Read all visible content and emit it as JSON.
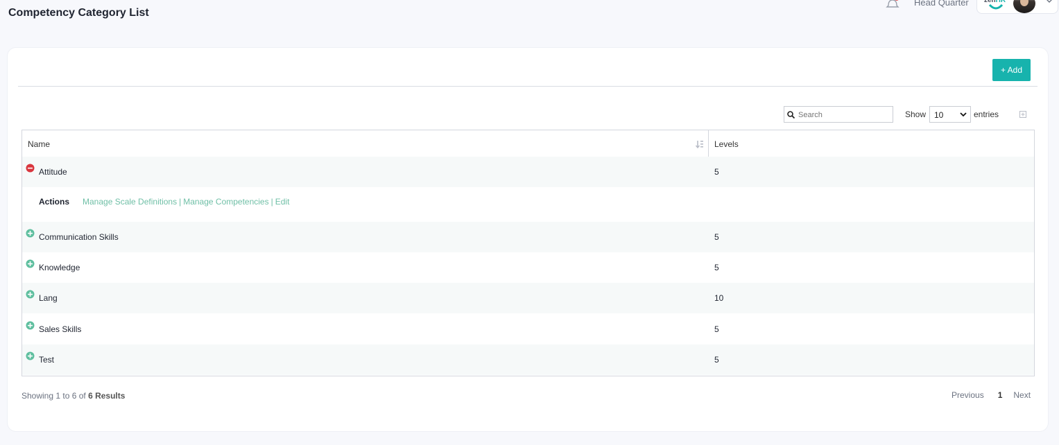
{
  "page": {
    "title": "Competency Category List"
  },
  "header": {
    "branch": "Head Quarter",
    "logo_text": "zen",
    "logo_text_accent": "HR"
  },
  "toolbar": {
    "add_label": "+ Add"
  },
  "search": {
    "placeholder": "Search",
    "value": ""
  },
  "length": {
    "show_label": "Show",
    "value": "10",
    "entries_label": "entries"
  },
  "table": {
    "columns": [
      "Name",
      "Levels"
    ],
    "rows": [
      {
        "name": "Attitude",
        "levels": "5",
        "expanded": true
      },
      {
        "name": "Communication Skills",
        "levels": "5",
        "expanded": false
      },
      {
        "name": "Knowledge",
        "levels": "5",
        "expanded": false
      },
      {
        "name": "Lang",
        "levels": "10",
        "expanded": false
      },
      {
        "name": "Sales Skills",
        "levels": "5",
        "expanded": false
      },
      {
        "name": "Test",
        "levels": "5",
        "expanded": false
      }
    ],
    "actions": {
      "label": "Actions",
      "links": [
        "Manage Scale Definitions",
        "Manage Competencies",
        "Edit"
      ],
      "separator": "|"
    }
  },
  "footer": {
    "info_prefix": "Showing 1 to 6 of ",
    "info_total": "6 Results",
    "previous": "Previous",
    "current_page": "1",
    "next": "Next"
  },
  "colors": {
    "accent": "#17b3ad",
    "link": "#6fbfa6",
    "collapse": "#d9363e",
    "expand": "#5fbf9f"
  }
}
